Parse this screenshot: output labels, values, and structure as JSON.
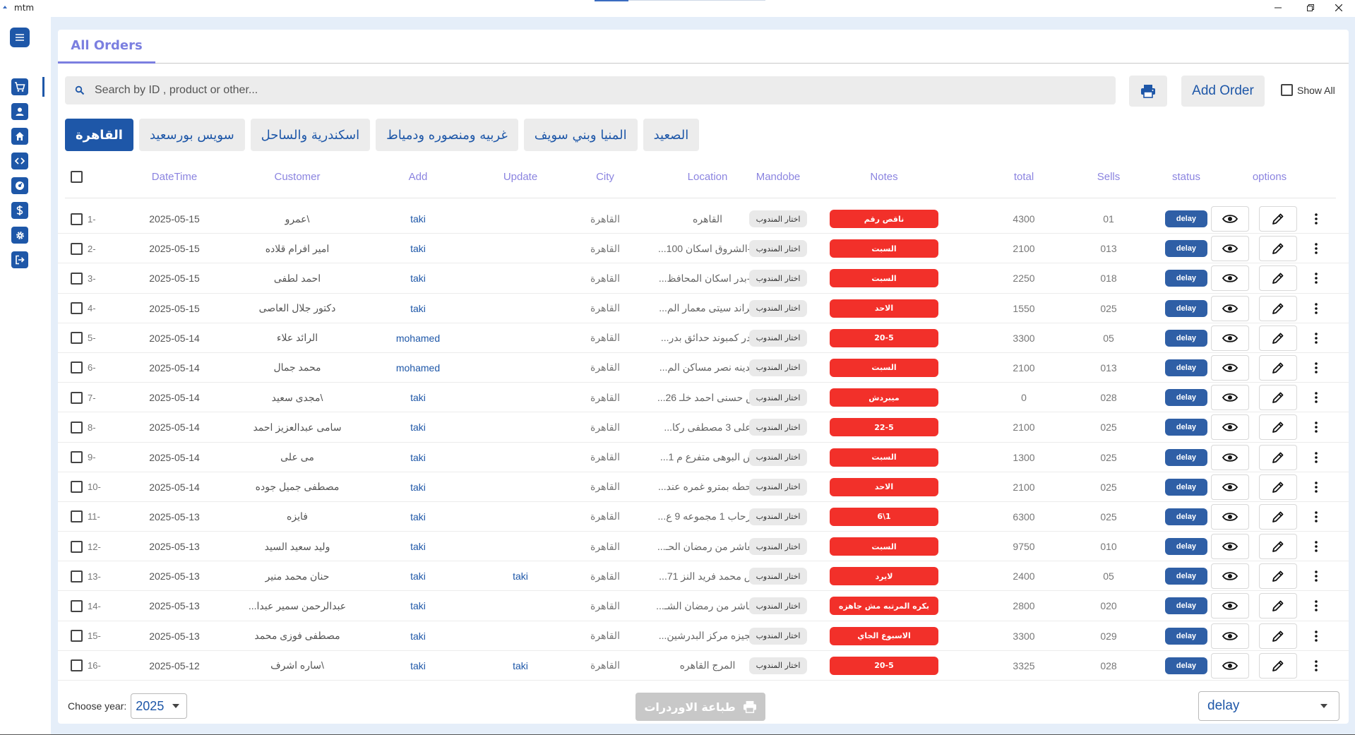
{
  "window": {
    "title": "mtm"
  },
  "tabs": [
    {
      "label": "All Orders"
    }
  ],
  "search": {
    "placeholder": "Search by ID , product or other..."
  },
  "toolbar": {
    "add_label": "Add Order",
    "show_all_label": "Show All"
  },
  "regions": [
    {
      "label": "القاهرة",
      "active": true
    },
    {
      "label": "سويس بورسعيد"
    },
    {
      "label": "اسكندرية والساحل"
    },
    {
      "label": "غربيه ومنصوره ودمياط"
    },
    {
      "label": "المنيا وبني سويف"
    },
    {
      "label": "الصعيد"
    }
  ],
  "columns": {
    "datetime": "DateTime",
    "customer": "Customer",
    "add": "Add",
    "update": "Update",
    "city": "City",
    "location": "Location",
    "mandobe": "Mandobe",
    "notes": "Notes",
    "total": "total",
    "sells": "Sells",
    "status": "status",
    "options": "options"
  },
  "rows": [
    {
      "num": "1-",
      "date": "2025-05-15",
      "customer": "\\عمرو",
      "add": "taki",
      "update": "",
      "city": "القاهرة",
      "location": "القاهره",
      "mandobe": "اختار المندوب",
      "note": "ناقص رقم",
      "total": "4300",
      "sells": "01",
      "status": "delay"
    },
    {
      "num": "2-",
      "date": "2025-05-15",
      "customer": "امير افرام قلاده",
      "add": "taki",
      "update": "",
      "city": "القاهرة",
      "location": "م-الشروق اسكان 100...",
      "mandobe": "اختار المندوب",
      "note": "السبت",
      "total": "2100",
      "sells": "013",
      "status": "delay"
    },
    {
      "num": "3-",
      "date": "2025-05-15",
      "customer": "احمد لطفى",
      "add": "taki",
      "update": "",
      "city": "القاهرة",
      "location": "م-بدر اسكان المحافظ...",
      "mandobe": "اختار المندوب",
      "note": "السبت",
      "total": "2250",
      "sells": "018",
      "status": "delay"
    },
    {
      "num": "4-",
      "date": "2025-05-15",
      "customer": "دكتور جلال العاصى",
      "add": "taki",
      "update": "",
      "city": "القاهرة",
      "location": "جراند سيتى معمار الم...",
      "mandobe": "اختار المندوب",
      "note": "الاحد",
      "total": "1550",
      "sells": "025",
      "status": "delay"
    },
    {
      "num": "5-",
      "date": "2025-05-14",
      "customer": "الرائد علاء",
      "add": "mohamed",
      "update": "",
      "city": "القاهرة",
      "location": "بدر كمبوند حدائق بدر...",
      "mandobe": "اختار المندوب",
      "note": "20-5",
      "total": "3300",
      "sells": "05",
      "status": "delay"
    },
    {
      "num": "6-",
      "date": "2025-05-14",
      "customer": "محمد جمال",
      "add": "mohamed",
      "update": "",
      "city": "القاهرة",
      "location": "مدينه نصر مساكن الم...",
      "mandobe": "اختار المندوب",
      "note": "السبت",
      "total": "2100",
      "sells": "013",
      "status": "delay"
    },
    {
      "num": "7-",
      "date": "2025-05-14",
      "customer": "\\مجدى سعيد",
      "add": "taki",
      "update": "",
      "city": "القاهرة",
      "location": "ش حسنى احمد خلـ 26...",
      "mandobe": "اختار المندوب",
      "note": "ميبردش",
      "total": "0",
      "sells": "028",
      "status": "delay"
    },
    {
      "num": "8-",
      "date": "2025-05-14",
      "customer": "سامى عبدالعزيز احمد",
      "add": "taki",
      "update": "",
      "city": "القاهرة",
      "location": "على 3 مصطفى ركا...",
      "mandobe": "اختار المندوب",
      "note": "22-5",
      "total": "2100",
      "sells": "025",
      "status": "delay"
    },
    {
      "num": "9-",
      "date": "2025-05-14",
      "customer": "مى على",
      "add": "taki",
      "update": "",
      "city": "القاهرة",
      "location": "ش البوهى متفرع م 1...",
      "mandobe": "اختار المندوب",
      "note": "السبت",
      "total": "1300",
      "sells": "025",
      "status": "delay"
    },
    {
      "num": "10-",
      "date": "2025-05-14",
      "customer": "مصطفى جميل جوده",
      "add": "taki",
      "update": "",
      "city": "القاهرة",
      "location": "محطه بمترو غمره عند...",
      "mandobe": "اختار المندوب",
      "note": "الاحد",
      "total": "2100",
      "sells": "025",
      "status": "delay"
    },
    {
      "num": "11-",
      "date": "2025-05-13",
      "customer": "فايزه",
      "add": "taki",
      "update": "",
      "city": "القاهرة",
      "location": "الرحاب 1 مجموعه 9 ع...",
      "mandobe": "اختار المندوب",
      "note": "6\\1",
      "total": "6300",
      "sells": "025",
      "status": "delay"
    },
    {
      "num": "12-",
      "date": "2025-05-13",
      "customer": "وليد سعيد السيد",
      "add": "taki",
      "update": "",
      "city": "القاهرة",
      "location": "العاشر من رمضان الحـ...",
      "mandobe": "اختار المندوب",
      "note": "السبت",
      "total": "9750",
      "sells": "010",
      "status": "delay"
    },
    {
      "num": "13-",
      "date": "2025-05-13",
      "customer": "حنان محمد منير",
      "add": "taki",
      "update": "taki",
      "city": "القاهرة",
      "location": "ش محمد فريد النز 71...",
      "mandobe": "اختار المندوب",
      "note": "لايرد",
      "total": "2400",
      "sells": "05",
      "status": "delay"
    },
    {
      "num": "14-",
      "date": "2025-05-13",
      "customer": "عبدالرحمن سمير عبدا...",
      "add": "taki",
      "update": "",
      "city": "القاهرة",
      "location": "العاشر من رمضان الشـ...",
      "mandobe": "اختار المندوب",
      "note": "بكره المرتبه مش جاهزه",
      "total": "2800",
      "sells": "020",
      "status": "delay"
    },
    {
      "num": "15-",
      "date": "2025-05-13",
      "customer": "مصطفى فوزى محمد",
      "add": "taki",
      "update": "",
      "city": "القاهرة",
      "location": "الجيزه مركز البدرشين...",
      "mandobe": "اختار المندوب",
      "note": "الاسبوع الجاي",
      "total": "3300",
      "sells": "029",
      "status": "delay"
    },
    {
      "num": "16-",
      "date": "2025-05-12",
      "customer": "\\ساره اشرف",
      "add": "taki",
      "update": "taki",
      "city": "القاهرة",
      "location": "المرج القاهره",
      "mandobe": "اختار المندوب",
      "note": "20-5",
      "total": "3325",
      "sells": "028",
      "status": "delay"
    }
  ],
  "footer": {
    "year_label": "Choose year:",
    "year_value": "2025",
    "print_label": "طباعة الاوردرات",
    "status_value": "delay"
  },
  "colors": {
    "primary": "#1e57a8",
    "accent": "#7b7fe0",
    "note_red": "#f2302a",
    "status_blue": "#2f5fa6"
  },
  "icons": [
    "hamburger-icon",
    "cart-icon",
    "user-icon",
    "home-icon",
    "code-icon",
    "dashboard-icon",
    "dollar-icon",
    "gear-icon",
    "logout-icon",
    "search-icon",
    "printer-icon",
    "eye-icon",
    "pencil-icon",
    "more-vertical-icon",
    "chevron-down-icon"
  ]
}
